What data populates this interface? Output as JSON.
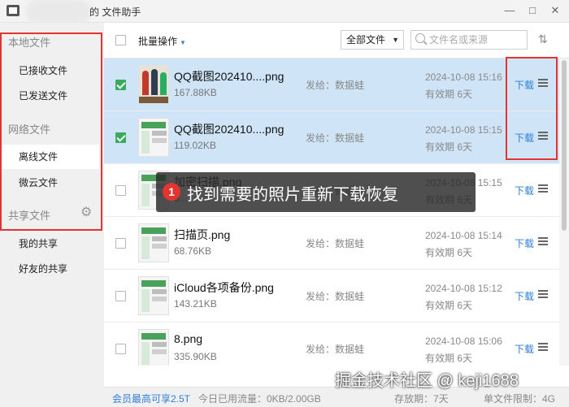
{
  "window": {
    "title": "的 文件助手",
    "controls": [
      "min",
      "max",
      "close"
    ]
  },
  "sidebar": {
    "sections": [
      {
        "label": "本地文件",
        "items": [
          {
            "label": "已接收文件"
          },
          {
            "label": "已发送文件"
          }
        ]
      },
      {
        "label": "网络文件",
        "items": [
          {
            "label": "离线文件"
          },
          {
            "label": "微云文件"
          }
        ]
      },
      {
        "label": "共享文件",
        "items": [
          {
            "label": "我的共享"
          },
          {
            "label": "好友的共享"
          }
        ]
      }
    ],
    "active_item": "离线文件"
  },
  "toolbar": {
    "batch_label": "批量操作",
    "filter_value": "全部文件",
    "search_placeholder": "文件名或来源"
  },
  "files": [
    {
      "name": "QQ截图202410....png",
      "size": "167.88KB",
      "sender": "发给：数据蛙",
      "date": "2024-10-08 15:16",
      "expiry": "有效期 6天",
      "download": "下载",
      "checked": true,
      "thumb": "photo-icon"
    },
    {
      "name": "QQ截图202410....png",
      "size": "119.02KB",
      "sender": "发给：数据蛙",
      "date": "2024-10-08 15:15",
      "expiry": "有效期 6天",
      "download": "下载",
      "checked": true,
      "thumb": "screenshot-icon"
    },
    {
      "name": "加密扫描.png",
      "size": "6...",
      "sender": "发给：数据蛙",
      "date": "2024-10-08 15:15",
      "expiry": "有效期 6天",
      "download": "下载",
      "checked": false,
      "thumb": "screenshot-icon"
    },
    {
      "name": "扫描页.png",
      "size": "68.76KB",
      "sender": "发给：数据蛙",
      "date": "2024-10-08 15:14",
      "expiry": "有效期 6天",
      "download": "下载",
      "checked": false,
      "thumb": "screenshot-icon"
    },
    {
      "name": "iCloud各项备份.png",
      "size": "143.21KB",
      "sender": "发给：数据蛙",
      "date": "2024-10-08 15:12",
      "expiry": "有效期 6天",
      "download": "下载",
      "checked": false,
      "thumb": "screenshot-icon"
    },
    {
      "name": "8.png",
      "size": "335.90KB",
      "sender": "发给：数据蛙",
      "date": "2024-10-08 15:06",
      "expiry": "有效期 6天",
      "download": "下载",
      "checked": false,
      "thumb": "screenshot-icon"
    }
  ],
  "overlay": {
    "number": "1",
    "text": "找到需要的照片重新下载恢复"
  },
  "statusbar": {
    "vip": "会员最高可享2.5T",
    "traffic": "今日已用流量：0KB/2.00GB",
    "period": "存放期：7天",
    "limit": "单文件限制：4G"
  },
  "watermark": "掘金技术社区 @ keji1688",
  "colors": {
    "accent": "#2e7fd6",
    "selected_row": "#cfe5f7",
    "check": "#3aab5c",
    "highlight_box": "#e3342f"
  }
}
